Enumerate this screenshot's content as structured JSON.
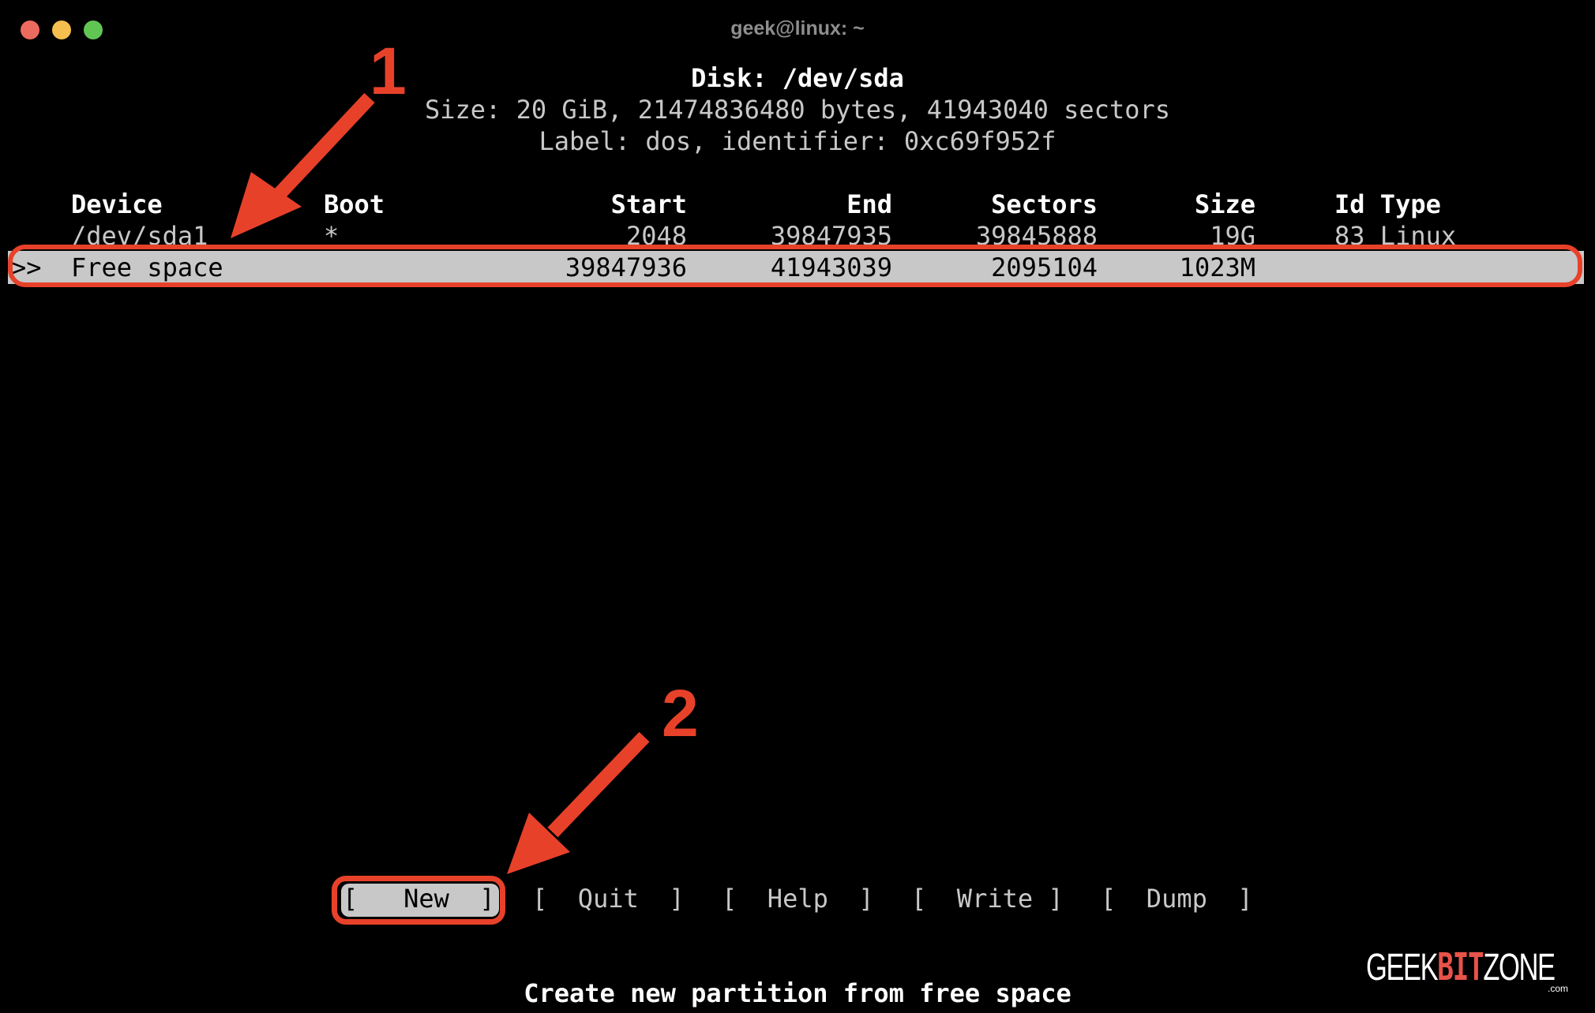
{
  "window": {
    "title": "geek@linux: ~",
    "traffic_lights": [
      "close",
      "minimize",
      "maximize"
    ]
  },
  "disk": {
    "title": "Disk: /dev/sda",
    "size_line": "Size: 20 GiB, 21474836480 bytes, 41943040 sectors",
    "label_line": "Label: dos, identifier: 0xc69f952f"
  },
  "table": {
    "columns": [
      "Device",
      "Boot",
      "Start",
      "End",
      "Sectors",
      "Size",
      "Id Type"
    ],
    "rows": [
      {
        "selected": false,
        "marker": "",
        "device": "/dev/sda1",
        "boot": "*",
        "start": "2048",
        "end": "39847935",
        "sectors": "39845888",
        "size": "19G",
        "id_type": "83 Linux"
      },
      {
        "selected": true,
        "marker": ">>",
        "device": "Free space",
        "boot": "",
        "start": "39847936",
        "end": "41943039",
        "sectors": "2095104",
        "size": "1023M",
        "id_type": ""
      }
    ]
  },
  "menu": {
    "buttons": [
      {
        "label": "[   New  ]",
        "selected": true
      },
      {
        "label": "[  Quit  ]",
        "selected": false
      },
      {
        "label": "[  Help  ]",
        "selected": false
      },
      {
        "label": "[  Write ]",
        "selected": false
      },
      {
        "label": "[  Dump  ]",
        "selected": false
      }
    ]
  },
  "status_text": "Create new partition from free space",
  "annotations": {
    "step1": "1",
    "step2": "2",
    "color": "#e8412a"
  },
  "watermark": {
    "part1": "GEEK",
    "part2": "BIT",
    "part3": "ZONE",
    "suffix": ".com"
  }
}
